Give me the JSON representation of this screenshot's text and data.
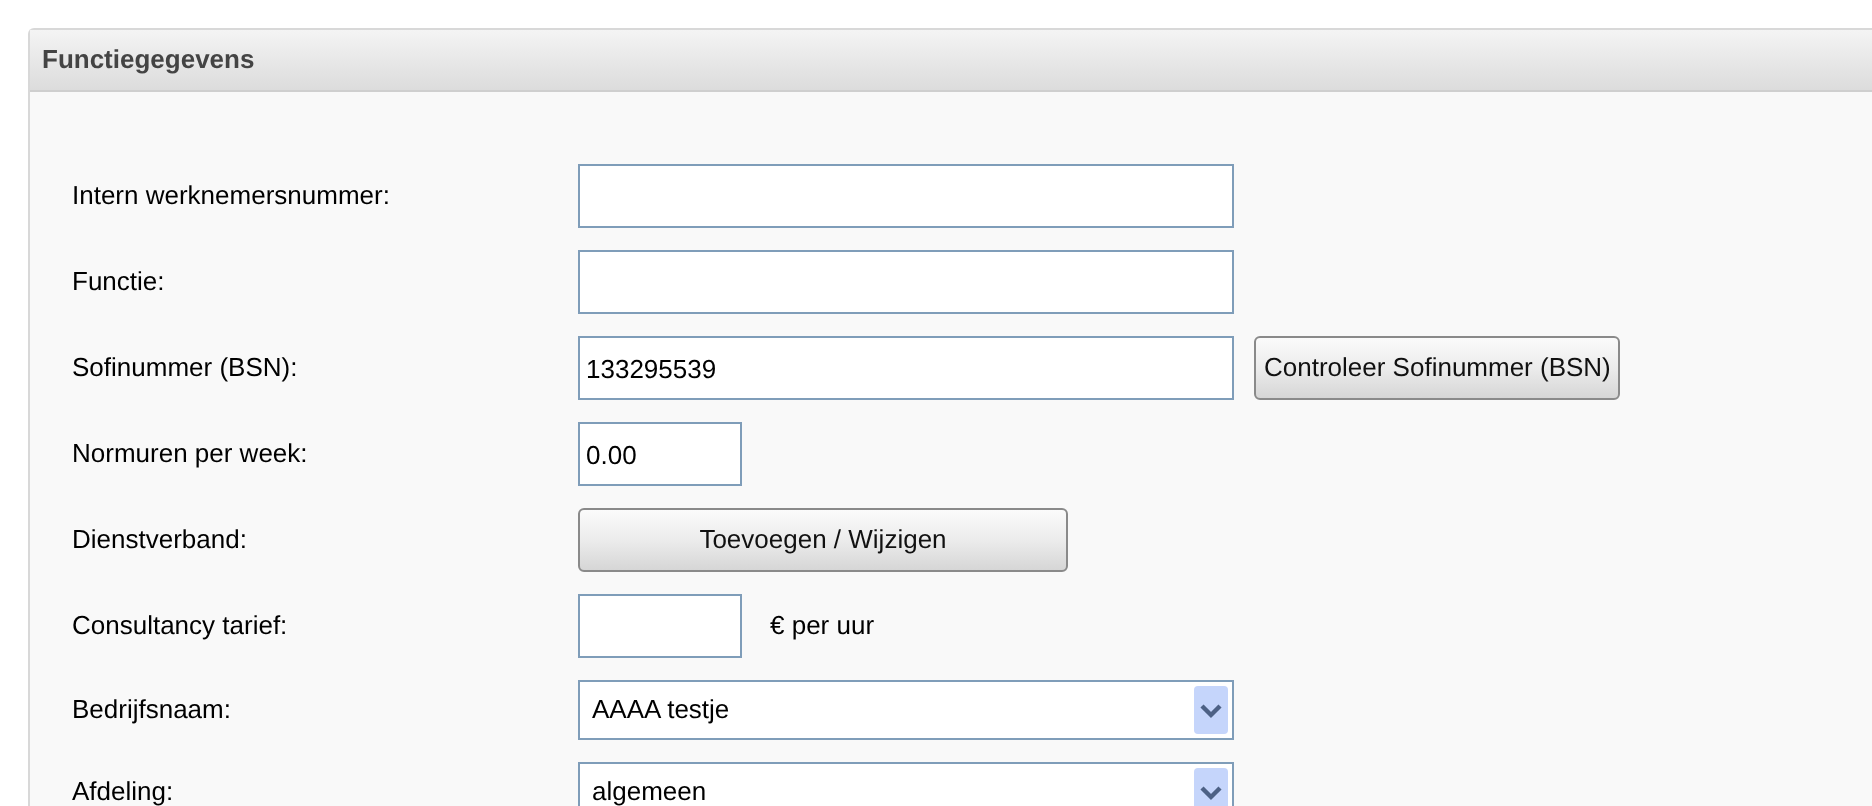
{
  "panel": {
    "title": "Functiegegevens"
  },
  "rows": [
    {
      "label": "Intern werknemersnummer:",
      "kind": "text",
      "value": ""
    },
    {
      "label": "Functie:",
      "kind": "text",
      "value": ""
    },
    {
      "label": "Sofinummer (BSN):",
      "kind": "text",
      "value": "133295539",
      "button": "Controleer Sofinummer (BSN)"
    },
    {
      "label": "Normuren per week:",
      "kind": "short",
      "value": "0.00"
    },
    {
      "label": "Dienstverband:",
      "kind": "button",
      "button": "Toevoegen / Wijzigen"
    },
    {
      "label": "Consultancy tarief:",
      "kind": "short",
      "value": "",
      "suffix": "€ per uur"
    },
    {
      "label": "Bedrijfsnaam:",
      "kind": "select",
      "value": "AAAA testje"
    },
    {
      "label": "Afdeling:",
      "kind": "select",
      "value": "algemeen"
    }
  ]
}
